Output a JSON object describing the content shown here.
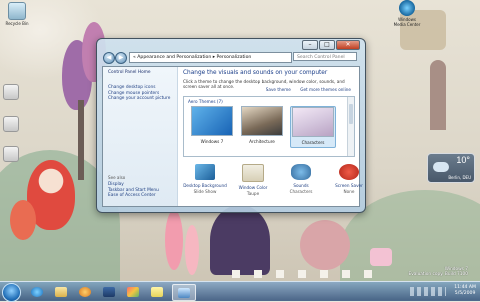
{
  "desktop": {
    "icons": [
      {
        "label": "Recycle Bin"
      },
      {
        "label": "Windows Media Center"
      }
    ],
    "weather": {
      "temp": "10°",
      "city": "Berlin, DEU"
    },
    "watermark": {
      "line1": "Windows 7",
      "line2": "Evaluation copy. Build 7100"
    }
  },
  "window": {
    "breadcrumb": "« Appearance and Personalization ▸ Personalization",
    "search_placeholder": "Search Control Panel",
    "controls": {
      "minimize": "–",
      "maximize": "□",
      "close": "✕"
    },
    "nav": {
      "back": "◀",
      "forward": "▶"
    },
    "left": {
      "home": "Control Panel Home",
      "tasks": [
        "Change desktop icons",
        "Change mouse pointers",
        "Change your account picture"
      ],
      "see_also_label": "See also",
      "see_also": [
        "Display",
        "Taskbar and Start Menu",
        "Ease of Access Center"
      ]
    },
    "main": {
      "heading": "Change the visuals and sounds on your computer",
      "subtitle": "Click a theme to change the desktop background, window color, sounds, and screen saver all at once.",
      "save_theme": "Save theme",
      "get_more": "Get more themes online",
      "category": "Aero Themes (7)",
      "themes": [
        {
          "name": "Windows 7",
          "selected": false
        },
        {
          "name": "Architecture",
          "selected": false
        },
        {
          "name": "Characters",
          "selected": true
        }
      ],
      "settings": [
        {
          "label": "Desktop Background",
          "value": "Slide Show"
        },
        {
          "label": "Window Color",
          "value": "Taupe"
        },
        {
          "label": "Sounds",
          "value": "Characters"
        },
        {
          "label": "Screen Saver",
          "value": "None"
        }
      ]
    }
  },
  "taskbar": {
    "time": "11:44 AM",
    "date": "5/5/2009",
    "apps": [
      "internet-explorer",
      "windows-explorer",
      "media-player",
      "paint",
      "sticky-notes",
      "control-panel"
    ]
  },
  "colors": {
    "link": "#1f3f82",
    "heading": "#1a3d88",
    "accent": "#7fb2d9"
  }
}
